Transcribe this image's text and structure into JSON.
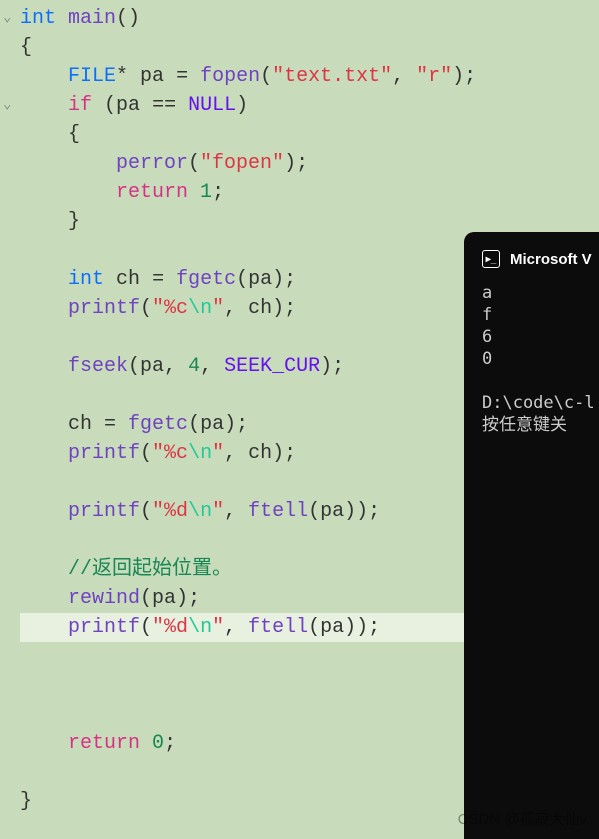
{
  "code": {
    "l1": {
      "kw1": "int",
      "func": "main",
      "par": "()"
    },
    "l2": "{",
    "l3": {
      "indent": "    ",
      "type": "FILE",
      "star": "* ",
      "var": "pa",
      "eq": " = ",
      "func": "fopen",
      "p1": "(",
      "str1": "\"text.txt\"",
      "comma": ", ",
      "str2": "\"r\"",
      "p2": ");"
    },
    "l4": {
      "indent": "    ",
      "kw": "if",
      "p1": " (",
      "var": "pa",
      "eq": " == ",
      "null": "NULL",
      "p2": ")"
    },
    "l5": "    {",
    "l6": {
      "indent": "        ",
      "func": "perror",
      "p1": "(",
      "str": "\"fopen\"",
      "p2": ");"
    },
    "l7": {
      "indent": "        ",
      "kw": "return",
      "sp": " ",
      "num": "1",
      "semi": ";"
    },
    "l8": "    }",
    "l9": "",
    "l10": {
      "indent": "    ",
      "type": "int",
      "sp": " ",
      "var": "ch",
      "eq": " = ",
      "func": "fgetc",
      "p1": "(",
      "arg": "pa",
      "p2": ");"
    },
    "l11": {
      "indent": "    ",
      "func": "printf",
      "p1": "(",
      "str1": "\"%c",
      "esc": "\\n",
      "str2": "\"",
      "comma": ", ",
      "arg": "ch",
      "p2": ");"
    },
    "l12": "",
    "l13": {
      "indent": "    ",
      "func": "fseek",
      "p1": "(",
      "arg1": "pa",
      "c1": ", ",
      "num": "4",
      "c2": ", ",
      "macro": "SEEK_CUR",
      "p2": ");"
    },
    "l14": "",
    "l15": {
      "indent": "    ",
      "var": "ch",
      "eq": " = ",
      "func": "fgetc",
      "p1": "(",
      "arg": "pa",
      "p2": ");"
    },
    "l16": {
      "indent": "    ",
      "func": "printf",
      "p1": "(",
      "str1": "\"%c",
      "esc": "\\n",
      "str2": "\"",
      "comma": ", ",
      "arg": "ch",
      "p2": ");"
    },
    "l17": "",
    "l18": {
      "indent": "    ",
      "func": "printf",
      "p1": "(",
      "str1": "\"%d",
      "esc": "\\n",
      "str2": "\"",
      "comma": ", ",
      "func2": "ftell",
      "p3": "(",
      "arg": "pa",
      "p4": "));"
    },
    "l19": "",
    "l20": {
      "indent": "    ",
      "comment": "//返回起始位置。"
    },
    "l21": {
      "indent": "    ",
      "func": "rewind",
      "p1": "(",
      "arg": "pa",
      "p2": ");"
    },
    "l22": {
      "indent": "    ",
      "func": "printf",
      "p1": "(",
      "str1": "\"%d",
      "esc": "\\n",
      "str2": "\"",
      "comma": ", ",
      "func2": "ftell",
      "p3": "(",
      "arg": "pa",
      "p4": "));"
    },
    "l23": "",
    "l24": "",
    "l25": "",
    "l26": {
      "indent": "    ",
      "kw": "return",
      "sp": " ",
      "num": "0",
      "semi": ";"
    },
    "l27": "",
    "l28": "}"
  },
  "terminal": {
    "title": "Microsoft V",
    "out1": "a",
    "out2": "f",
    "out3": "6",
    "out4": "0",
    "path": "D:\\code\\c-l",
    "prompt": "按任意键关"
  },
  "watermark": "CSDN @孤寂大仙v"
}
